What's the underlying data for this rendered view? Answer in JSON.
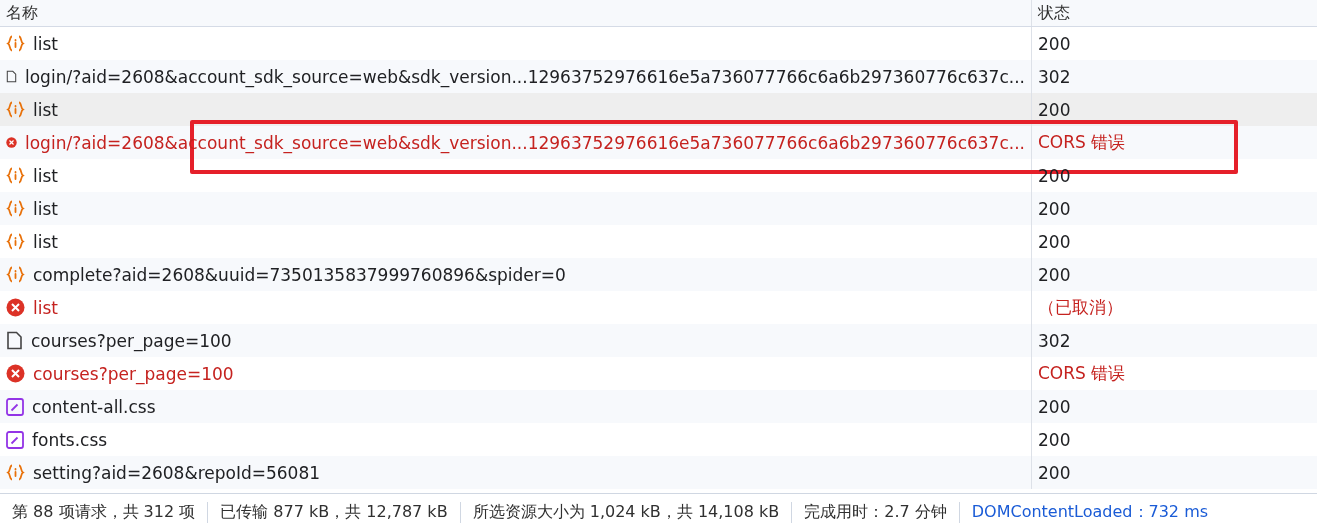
{
  "table": {
    "columns": [
      "名称",
      "状态"
    ],
    "rows": [
      {
        "kind": "fetch",
        "name": "list",
        "status": "200",
        "error": false,
        "selected": false,
        "highlighted": false
      },
      {
        "kind": "document",
        "name": "login/?aid=2608&account_sdk_source=web&sdk_version...12963752976616e5a736077766c6a6b297360776c637c...",
        "status": "302",
        "error": false,
        "selected": false,
        "highlighted": false
      },
      {
        "kind": "fetch",
        "name": "list",
        "status": "200",
        "error": false,
        "selected": true,
        "highlighted": false
      },
      {
        "kind": "error",
        "name": "login/?aid=2608&account_sdk_source=web&sdk_version...12963752976616e5a736077766c6a6b297360776c637c...",
        "status": "CORS 错误",
        "error": true,
        "selected": false,
        "highlighted": true
      },
      {
        "kind": "fetch",
        "name": "list",
        "status": "200",
        "error": false,
        "selected": false,
        "highlighted": false
      },
      {
        "kind": "fetch",
        "name": "list",
        "status": "200",
        "error": false,
        "selected": false,
        "highlighted": false
      },
      {
        "kind": "fetch",
        "name": "list",
        "status": "200",
        "error": false,
        "selected": false,
        "highlighted": false
      },
      {
        "kind": "fetch",
        "name": "complete?aid=2608&uuid=7350135837999760896&spider=0",
        "status": "200",
        "error": false,
        "selected": false,
        "highlighted": false
      },
      {
        "kind": "error",
        "name": "list",
        "status": "（已取消）",
        "error": true,
        "selected": false,
        "highlighted": false
      },
      {
        "kind": "document",
        "name": "courses?per_page=100",
        "status": "302",
        "error": false,
        "selected": false,
        "highlighted": false
      },
      {
        "kind": "error",
        "name": "courses?per_page=100",
        "status": "CORS 错误",
        "error": true,
        "selected": false,
        "highlighted": false
      },
      {
        "kind": "css",
        "name": "content-all.css",
        "status": "200",
        "error": false,
        "selected": false,
        "highlighted": false
      },
      {
        "kind": "css",
        "name": "fonts.css",
        "status": "200",
        "error": false,
        "selected": false,
        "highlighted": false
      },
      {
        "kind": "fetch",
        "name": "setting?aid=2608&repoId=56081",
        "status": "200",
        "error": false,
        "selected": false,
        "highlighted": false
      }
    ]
  },
  "status_bar": [
    {
      "kind": "text",
      "text": "第 88 项请求，共 312 项"
    },
    {
      "kind": "text",
      "text": "已传输 877 kB，共 12,787 kB"
    },
    {
      "kind": "text",
      "text": "所选资源大小为 1,024 kB，共 14,108 kB"
    },
    {
      "kind": "text",
      "text": "完成用时：2.7 分钟"
    },
    {
      "kind": "link",
      "text": "DOMContentLoaded：732 ms"
    }
  ]
}
